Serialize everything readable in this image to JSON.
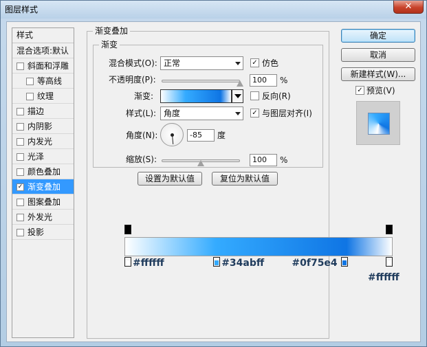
{
  "window": {
    "title": "图层样式",
    "close_glyph": "✕"
  },
  "style_list": {
    "header": "样式",
    "blend_options": "混合选项:默认",
    "items": [
      {
        "label": "斜面和浮雕",
        "checked": false,
        "indent": 0
      },
      {
        "label": "等高线",
        "checked": false,
        "indent": 1
      },
      {
        "label": "纹理",
        "checked": false,
        "indent": 1
      },
      {
        "label": "描边",
        "checked": false,
        "indent": 0
      },
      {
        "label": "内阴影",
        "checked": false,
        "indent": 0
      },
      {
        "label": "内发光",
        "checked": false,
        "indent": 0
      },
      {
        "label": "光泽",
        "checked": false,
        "indent": 0
      },
      {
        "label": "颜色叠加",
        "checked": false,
        "indent": 0
      },
      {
        "label": "渐变叠加",
        "checked": true,
        "indent": 0,
        "selected": true
      },
      {
        "label": "图案叠加",
        "checked": false,
        "indent": 0
      },
      {
        "label": "外发光",
        "checked": false,
        "indent": 0
      },
      {
        "label": "投影",
        "checked": false,
        "indent": 0
      }
    ]
  },
  "panel": {
    "outer_title": "渐变叠加",
    "inner_title": "渐变",
    "blend_mode_label": "混合模式(O):",
    "blend_mode_value": "正常",
    "dither_label": "仿色",
    "dither_checked": true,
    "opacity_label": "不透明度(P):",
    "opacity_value": "100",
    "opacity_unit": "%",
    "opacity_level": 1.0,
    "gradient_label": "渐变:",
    "reverse_label": "反向(R)",
    "reverse_checked": false,
    "style_label": "样式(L):",
    "style_value": "角度",
    "align_label": "与图层对齐(I)",
    "align_checked": true,
    "angle_label": "角度(N):",
    "angle_value": "-85",
    "angle_unit": "度",
    "scale_label": "缩放(S):",
    "scale_value": "100",
    "scale_unit": "%",
    "scale_level": 0.5,
    "make_default": "设置为默认值",
    "reset_default": "复位为默认值"
  },
  "buttons": {
    "ok": "确定",
    "cancel": "取消",
    "new_style": "新建样式(W)...",
    "preview_label": "预览(V)",
    "preview_checked": true
  },
  "gradient_stops": {
    "colors": [
      {
        "hex": "#ffffff",
        "label": "#ffffff",
        "location": 0.0
      },
      {
        "hex": "#34abff",
        "label": "#34abff",
        "location": 0.34
      },
      {
        "hex": "#0f75e4",
        "label": "#0f75e4",
        "location": 0.83
      },
      {
        "hex": "#ffffff",
        "label": "#ffffff",
        "location": 1.0
      }
    ],
    "opacity": [
      {
        "location": 0.0
      },
      {
        "location": 1.0
      }
    ]
  },
  "colors": {
    "selection": "#3399ff",
    "accent": "#1f3b5c"
  }
}
